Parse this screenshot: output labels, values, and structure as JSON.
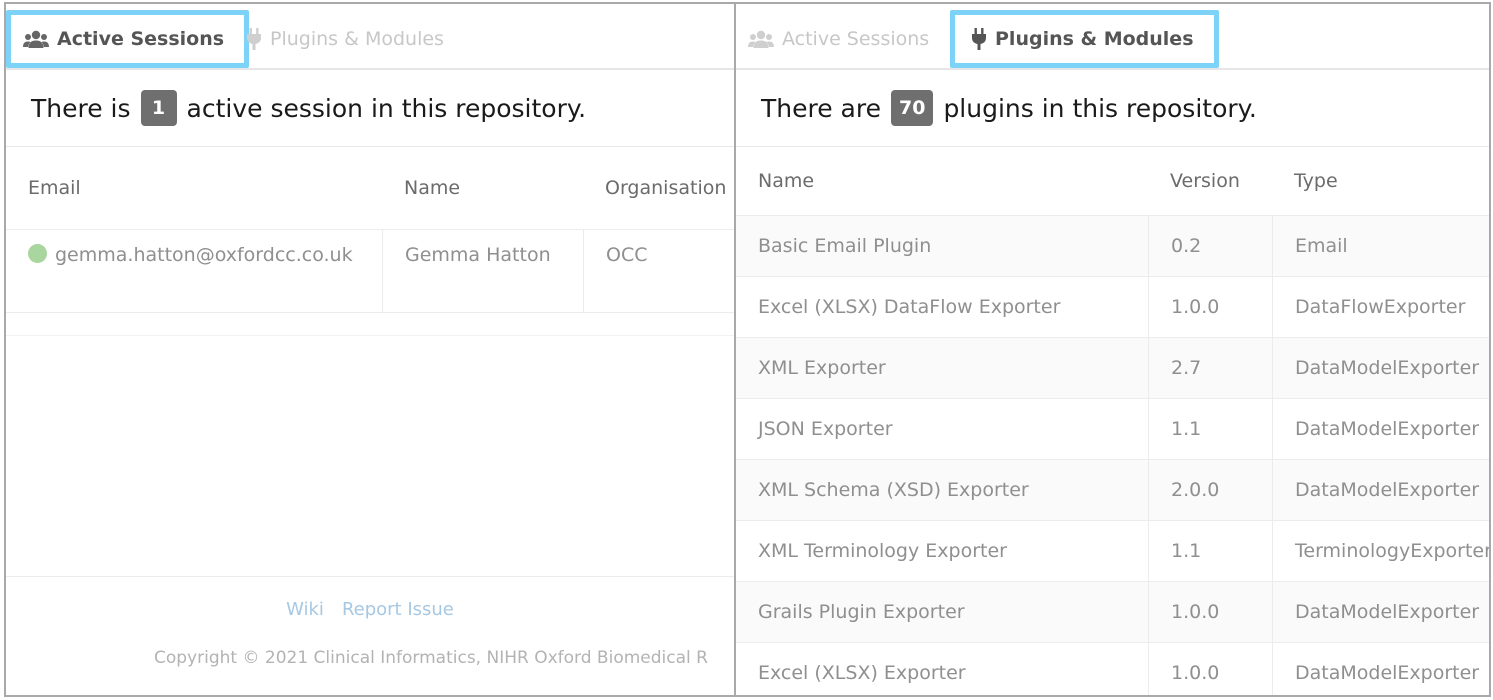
{
  "tabs": {
    "active_sessions": "Active Sessions",
    "plugins_modules": "Plugins & Modules"
  },
  "sessions": {
    "summary_prefix": "There is",
    "count": "1",
    "summary_suffix": "active session in this repository.",
    "columns": [
      "Email",
      "Name",
      "Organisation"
    ],
    "rows": [
      {
        "email": "gemma.hatton@oxfordcc.co.uk",
        "name": "Gemma Hatton",
        "organisation": "OCC",
        "status_color": "#a9d69e"
      }
    ]
  },
  "plugins": {
    "summary_prefix": "There are",
    "count": "70",
    "summary_suffix": "plugins in this repository.",
    "columns": [
      "Name",
      "Version",
      "Type"
    ],
    "rows": [
      {
        "name": "Basic Email Plugin",
        "version": "0.2",
        "type": "Email"
      },
      {
        "name": "Excel (XLSX) DataFlow Exporter",
        "version": "1.0.0",
        "type": "DataFlowExporter"
      },
      {
        "name": "XML Exporter",
        "version": "2.7",
        "type": "DataModelExporter"
      },
      {
        "name": "JSON Exporter",
        "version": "1.1",
        "type": "DataModelExporter"
      },
      {
        "name": "XML Schema (XSD) Exporter",
        "version": "2.0.0",
        "type": "DataModelExporter"
      },
      {
        "name": "XML Terminology Exporter",
        "version": "1.1",
        "type": "TerminologyExporter"
      },
      {
        "name": "Grails Plugin Exporter",
        "version": "1.0.0",
        "type": "DataModelExporter"
      },
      {
        "name": "Excel (XLSX) Exporter",
        "version": "1.0.0",
        "type": "DataModelExporter"
      }
    ]
  },
  "footer": {
    "wiki": "Wiki",
    "report_issue": "Report Issue",
    "copyright": "Copyright © 2021 Clinical Informatics, NIHR Oxford Biomedical R"
  },
  "icons": {
    "users": "users-icon",
    "plug": "plug-icon"
  },
  "colors": {
    "highlight": "#7dd3f7",
    "badge": "#6f6f6f",
    "status_online": "#a9d69e",
    "link": "#a6c8e3"
  }
}
